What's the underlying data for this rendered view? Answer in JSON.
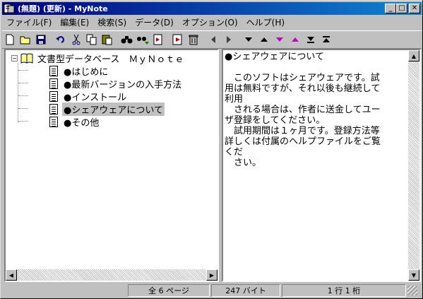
{
  "window": {
    "title": "(無題) (更新) - MyNote",
    "minimize": "_",
    "maximize": "□",
    "close": "✕"
  },
  "menu": [
    {
      "label": "ファイル(F)"
    },
    {
      "label": "編集(E)"
    },
    {
      "label": "検索(S)"
    },
    {
      "label": "データ(D)"
    },
    {
      "label": "オプション(O)"
    },
    {
      "label": "ヘルプ(H)"
    }
  ],
  "toolbar": {
    "new": "🗋",
    "open": "📂",
    "save": "💾",
    "undo": "↶",
    "cut": "✂",
    "copy": "⎘",
    "paste": "📋",
    "find": "🔍",
    "find_next": "🔎",
    "replace": "⇄",
    "import": "⤓",
    "delete": "🗑",
    "back": "◀",
    "forward": "▶",
    "down": "▼",
    "up": "▲",
    "down_pink": "▼",
    "up_pink": "▲",
    "bottom": "⏷",
    "top": "⏶"
  },
  "tree": {
    "root": "文書型データベース　ＭｙＮｏｔｅ",
    "items": [
      {
        "label": "●はじめに"
      },
      {
        "label": "●最新バージョンの入手方法"
      },
      {
        "label": "●インストール"
      },
      {
        "label": "●シェアウェアについて"
      },
      {
        "label": "●その他"
      }
    ]
  },
  "document": {
    "text": "●シェアウェアについて\n\n　このソフトはシェアウェアです。試\n用は無料ですが、それ以後も継続して\n利用\n　される場合は、作者に送金してユー\nザ登録をしてください。\n　試用期間は１ヶ月です。登録方法等\n詳しくは付属のヘルプファイルをご覧\nくだ\n　さい。"
  },
  "status": {
    "pages": "全 6 ページ",
    "bytes": "247 バイト",
    "position": "1 行 1 桁"
  }
}
